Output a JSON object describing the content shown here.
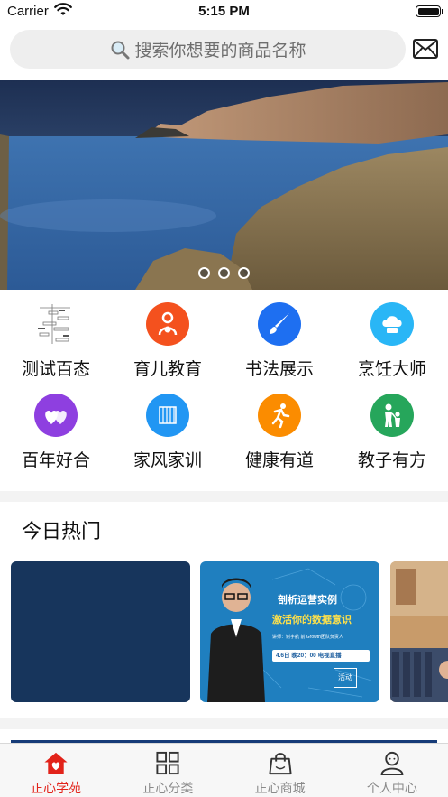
{
  "status_bar": {
    "carrier": "Carrier",
    "time": "5:15 PM"
  },
  "search": {
    "placeholder": "搜索你想要的商品名称"
  },
  "banner": {
    "slide_count": 3,
    "active_slide": 0
  },
  "categories": [
    {
      "label": "测试百态",
      "icon": "chart-thumbnail-icon",
      "color": "#ffffff"
    },
    {
      "label": "育儿教育",
      "icon": "mother-child-icon",
      "color": "#f4511e"
    },
    {
      "label": "书法展示",
      "icon": "brush-icon",
      "color": "#1e6ff1"
    },
    {
      "label": "烹饪大师",
      "icon": "chef-hat-icon",
      "color": "#29b6f6"
    },
    {
      "label": "百年好合",
      "icon": "hearts-icon",
      "color": "#8e3fe0"
    },
    {
      "label": "家风家训",
      "icon": "scroll-icon",
      "color": "#2196f3"
    },
    {
      "label": "健康有道",
      "icon": "runner-icon",
      "color": "#fb8c00"
    },
    {
      "label": "教子有方",
      "icon": "parent-child-icon",
      "color": "#26a65b"
    }
  ],
  "hot": {
    "title": "今日热门",
    "cards": [
      {
        "kind": "blank",
        "color": "#17355c"
      },
      {
        "kind": "poster",
        "color": "#1f7fbf",
        "headline_1": "剖析运营实例",
        "headline_2": "激活你的数据意识",
        "speaker_line": "讲师：谢宇航  前 Growth团队负责人",
        "schedule": "4.6日 晚20：00 电视直播",
        "stamp": "活动"
      },
      {
        "kind": "photo",
        "color": "#c89b6a"
      }
    ]
  },
  "tabbar": {
    "active_color": "#e2231a",
    "items": [
      {
        "label": "正心学苑",
        "icon": "home-heart-icon",
        "active": true
      },
      {
        "label": "正心分类",
        "icon": "grid-icon",
        "active": false
      },
      {
        "label": "正心商城",
        "icon": "shopping-bag-icon",
        "active": false
      },
      {
        "label": "个人中心",
        "icon": "person-icon",
        "active": false
      }
    ]
  }
}
